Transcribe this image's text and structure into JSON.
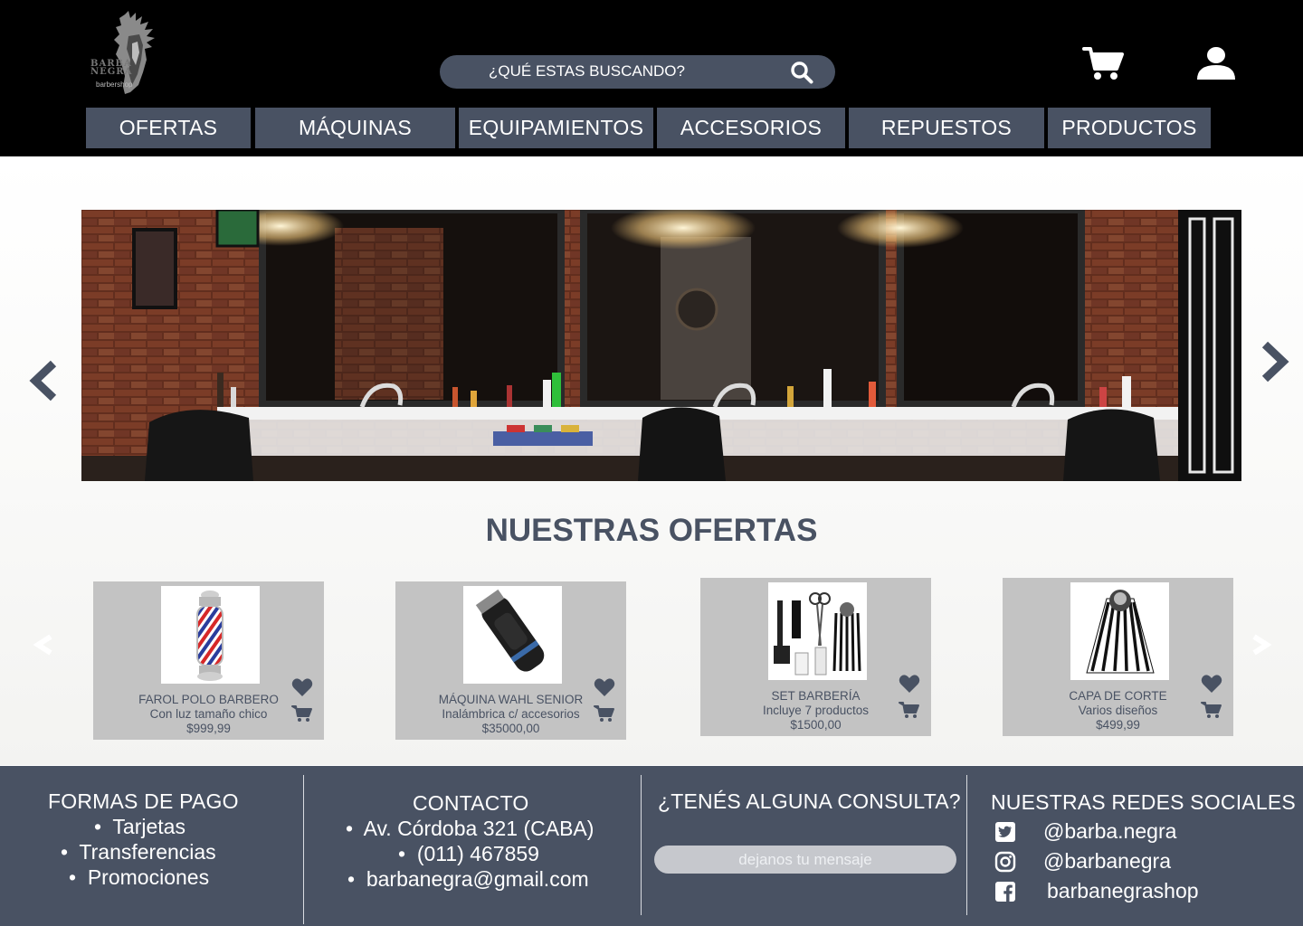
{
  "brand": {
    "logo_line1": "BARBA",
    "logo_line2": "NEGRA",
    "logo_sub": "barbershop"
  },
  "search": {
    "placeholder": "¿QUÉ ESTAS BUSCANDO?",
    "icon": "search-icon"
  },
  "header_icons": [
    "cart-icon",
    "user-icon"
  ],
  "nav": {
    "items": [
      {
        "label": "OFERTAS"
      },
      {
        "label": "MÁQUINAS"
      },
      {
        "label": "EQUIPAMIENTOS"
      },
      {
        "label": "ACCESORIOS"
      },
      {
        "label": "REPUESTOS"
      },
      {
        "label": "PRODUCTOS"
      }
    ]
  },
  "carousel": {
    "prev_icon": "chevron-left-icon",
    "next_icon": "chevron-right-icon"
  },
  "offers": {
    "title": "NUESTRAS OFERTAS",
    "cards": [
      {
        "name": "FAROL POLO BARBERO",
        "desc": "Con luz tamaño chico",
        "price": "$999,99"
      },
      {
        "name": "MÁQUINA WAHL SENIOR",
        "desc": "Inalámbrica c/ accesorios",
        "price": "$35000,00"
      },
      {
        "name": "SET BARBERÍA",
        "desc": "Incluye 7 productos",
        "price": "$1500,00"
      },
      {
        "name": "CAPA DE CORTE",
        "desc": "Varios diseños",
        "price": "$499,99"
      }
    ]
  },
  "footer": {
    "payment": {
      "title": "FORMAS DE PAGO",
      "items": [
        "Tarjetas",
        "Transferencias",
        "Promociones"
      ]
    },
    "contact": {
      "title": "CONTACTO",
      "items": [
        "Av. Córdoba 321 (CABA)",
        "(011) 467859",
        "barbanegra@gmail.com"
      ]
    },
    "query": {
      "title": "¿TENÉS ALGUNA CONSULTA?",
      "placeholder": "dejanos tu mensaje"
    },
    "social": {
      "title": "NUESTRAS REDES SOCIALES",
      "items": [
        {
          "icon": "twitter-icon",
          "handle": "@barba.negra"
        },
        {
          "icon": "instagram-icon",
          "handle": "@barbanegra"
        },
        {
          "icon": "facebook-icon",
          "handle": "barbanegrashop"
        }
      ]
    }
  },
  "colors": {
    "header_bg": "#000000",
    "accent": "#495263",
    "card_bg": "#c3c3c3",
    "input_bg": "#c6c8cd"
  }
}
